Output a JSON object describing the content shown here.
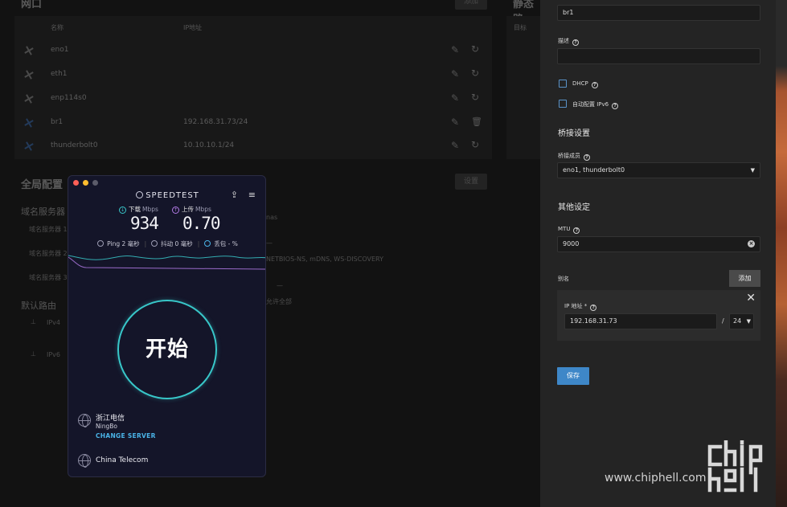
{
  "background": {
    "ports_title": "网口",
    "ports_add_button": "添加",
    "static_routes_title": "静态路",
    "static_routes_col_target": "目标",
    "ports_col_name": "名称",
    "ports_col_ip": "IP地址",
    "interfaces": [
      {
        "name": "eno1",
        "ip": "",
        "state": "disconnected"
      },
      {
        "name": "eth1",
        "ip": "",
        "state": "disconnected"
      },
      {
        "name": "enp114s0",
        "ip": "",
        "state": "disconnected"
      },
      {
        "name": "br1",
        "ip": "192.168.31.73/24",
        "state": "connected"
      },
      {
        "name": "thunderbolt0",
        "ip": "10.10.10.1/24",
        "state": "connected"
      }
    ],
    "global_title": "全局配置",
    "global_settings_button": "设置",
    "dns_title": "域名服务器",
    "dns_rows": [
      "域名服务器 1",
      "域名服务器 2",
      "域名服务器 3"
    ],
    "frag_nas": "nas",
    "frag_dash1": "—",
    "frag_netbios": "NETBIOS-NS, mDNS, WS-DISCOVERY",
    "frag_dash2": "—",
    "frag_allow_all": "允许全部",
    "default_route_title": "默认路由",
    "default_route_rows": [
      "IPv4",
      "IPv6"
    ]
  },
  "speedtest": {
    "brand": "SPEEDTEST",
    "download_label": "下载",
    "upload_label": "上传",
    "unit": "Mbps",
    "download_value": "934",
    "upload_value": "0.70",
    "ping": "Ping 2 毫秒",
    "jitter": "抖动 0 毫秒",
    "loss": "丢包 - %",
    "start_button": "开始",
    "isp_name": "浙江电信",
    "isp_city": "NingBo",
    "change_server": "CHANGE SERVER",
    "host_isp": "China Telecom",
    "colors": {
      "accent": "#38c7c9",
      "download": "#38c7c9",
      "upload": "#b27ae6"
    }
  },
  "panel": {
    "name_value": "br1",
    "description_label": "描述",
    "description_value": "",
    "dhcp_label": "DHCP",
    "dhcp_checked": false,
    "ipv6_auto_label": "自动配置 IPv6",
    "ipv6_auto_checked": false,
    "bridge_title": "桥接设置",
    "bridge_members_label": "桥接成员",
    "bridge_members_value": "eno1, thunderbolt0",
    "other_title": "其他设定",
    "mtu_label": "MTU",
    "mtu_value": "9000",
    "alias_label": "别名",
    "add_button": "添加",
    "ip_address_label": "IP 地址 *",
    "ip_address_value": "192.168.31.73",
    "prefix_separator": "/",
    "prefix_value": "24",
    "save_button": "保存",
    "colors": {
      "primary_button": "#3e87c8",
      "checkbox_border": "#5a93c9"
    }
  },
  "watermark": {
    "logo_text": "chip hell",
    "url": "www.chiphell.com"
  }
}
